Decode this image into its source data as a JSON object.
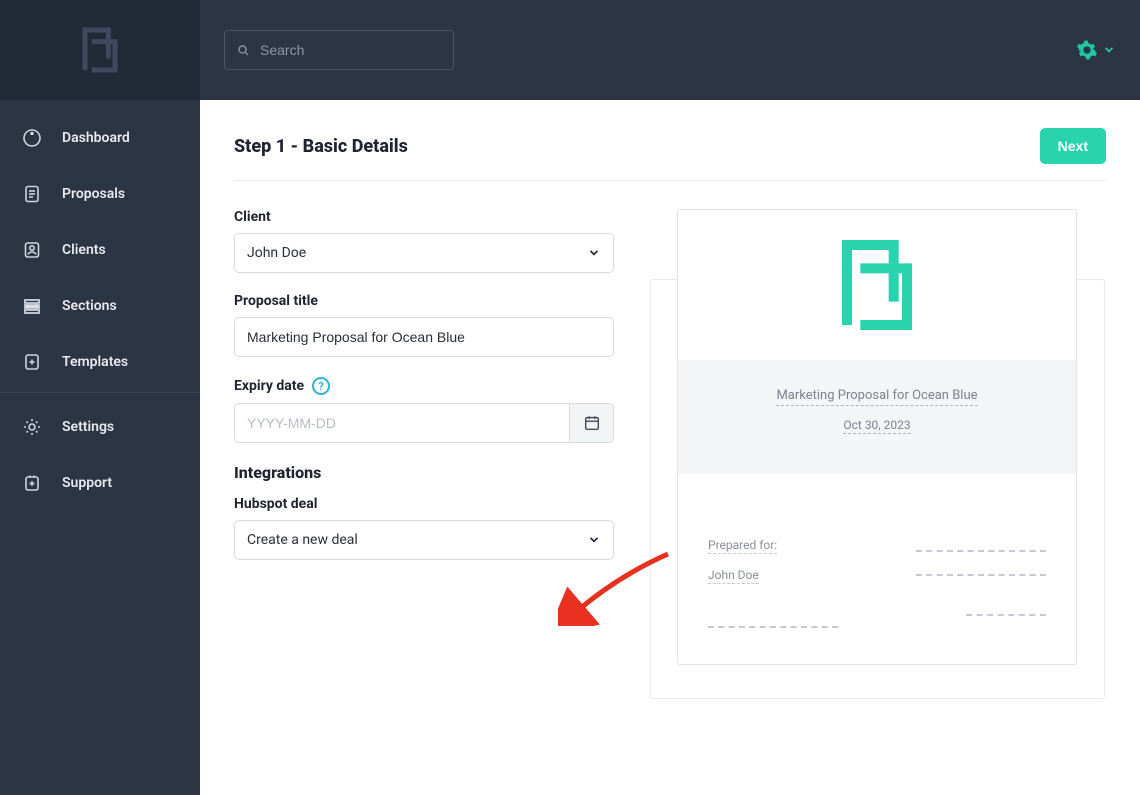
{
  "accent": "#29d3ae",
  "sidebar": {
    "items": [
      {
        "label": "Dashboard",
        "icon": "ring-icon"
      },
      {
        "label": "Proposals",
        "icon": "proposal-icon"
      },
      {
        "label": "Clients",
        "icon": "client-icon"
      },
      {
        "label": "Sections",
        "icon": "sections-icon"
      },
      {
        "label": "Templates",
        "icon": "template-icon"
      },
      {
        "label": "Settings",
        "icon": "settings-icon"
      },
      {
        "label": "Support",
        "icon": "support-icon"
      }
    ]
  },
  "header": {
    "search_placeholder": "Search"
  },
  "page": {
    "step_title": "Step 1 - Basic Details",
    "next_label": "Next"
  },
  "form": {
    "client_label": "Client",
    "client_value": "John Doe",
    "title_label": "Proposal title",
    "title_value": "Marketing Proposal for Ocean Blue",
    "expiry_label": "Expiry date",
    "expiry_placeholder": "YYYY-MM-DD",
    "integrations_heading": "Integrations",
    "hubspot_label": "Hubspot deal",
    "hubspot_value": "Create a new deal"
  },
  "preview": {
    "title": "Marketing Proposal for Ocean Blue",
    "date": "Oct 30, 2023",
    "prepared_for_label": "Prepared for:",
    "prepared_for_name": "John Doe"
  }
}
